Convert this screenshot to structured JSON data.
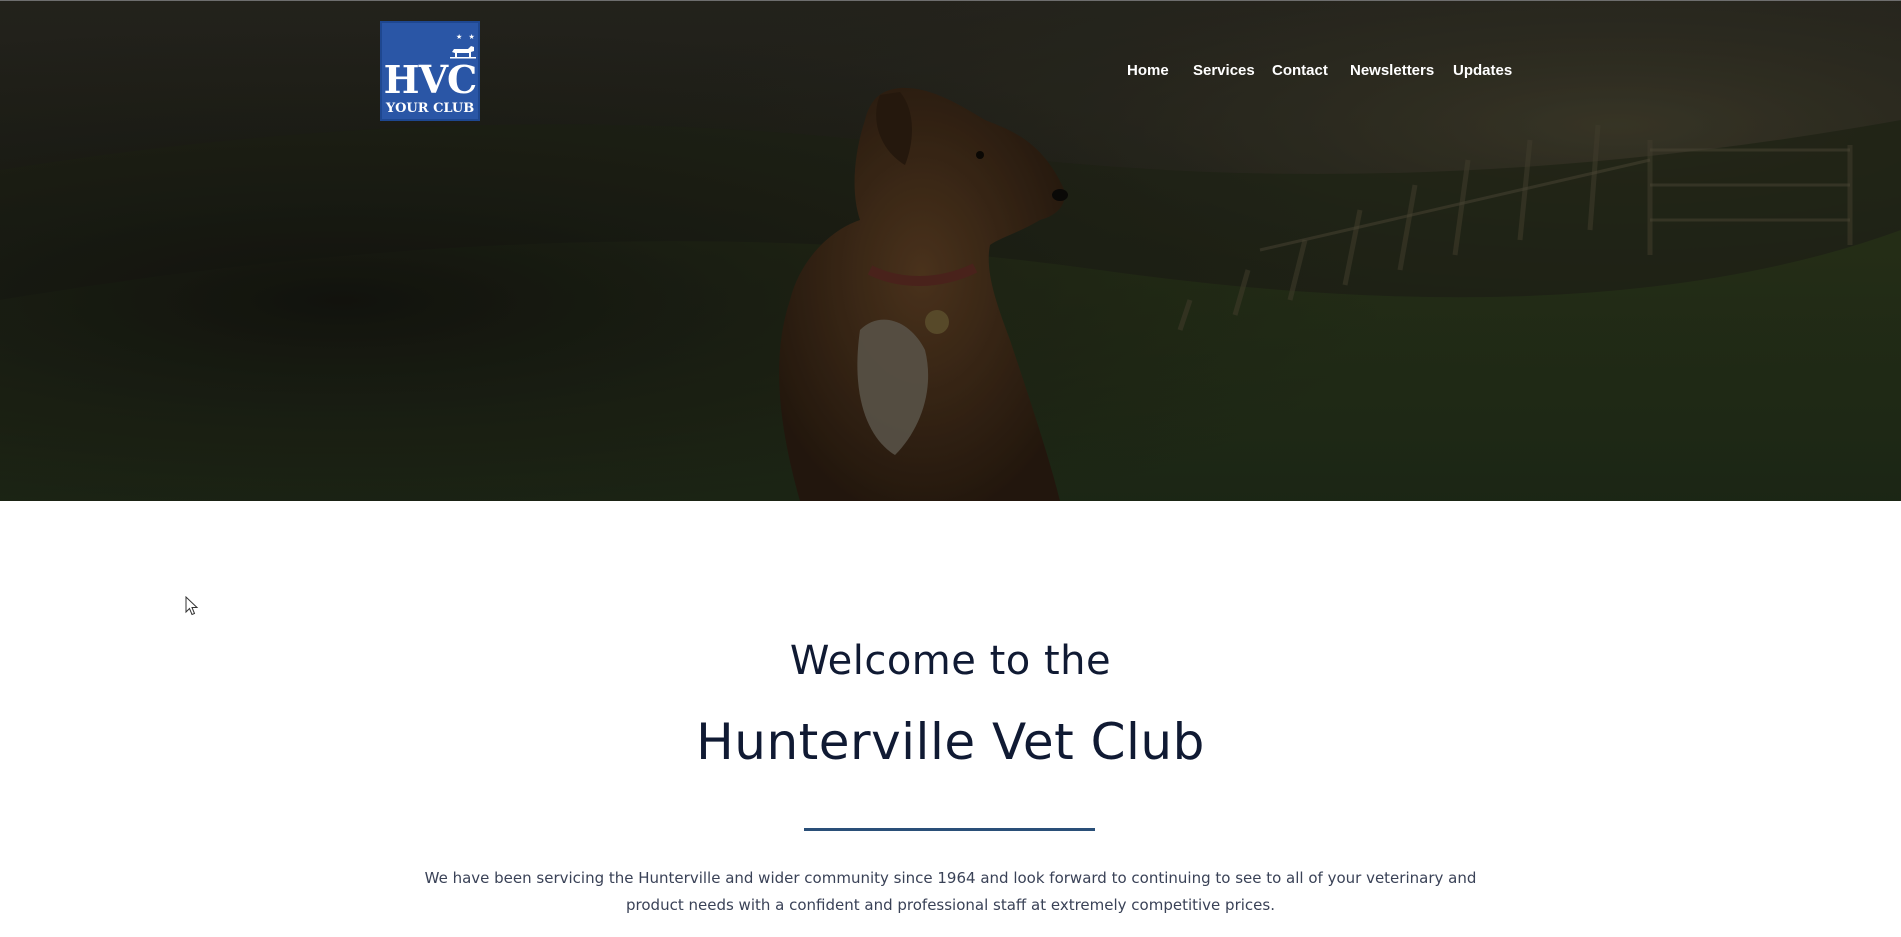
{
  "logo": {
    "main_text": "HVC",
    "sub_text": "YOUR CLUB",
    "stars": "★ ★",
    "background_color": "#2a56a6"
  },
  "nav": {
    "items": [
      {
        "label": "Home"
      },
      {
        "label": "Services"
      },
      {
        "label": "Contact"
      },
      {
        "label": "Newsletters"
      },
      {
        "label": "Updates"
      }
    ]
  },
  "hero": {
    "image_subject": "dog sitting in a grassy field at dusk"
  },
  "welcome": {
    "line1": "Welcome to the",
    "title": "Hunterville Vet Club",
    "intro": "We have been servicing the Hunterville and wider community since 1964 and look forward to continuing to see to all of your veterinary and product needs with a confident and professional staff at extremely competitive prices."
  },
  "colors": {
    "heading_text": "#101a33",
    "body_text": "#3a4257",
    "divider": "#2a4f78",
    "nav_text": "#ffffff"
  }
}
